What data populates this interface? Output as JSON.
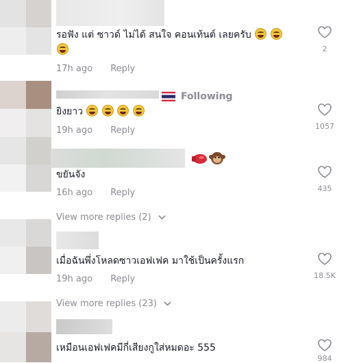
{
  "comments": [
    {
      "text": "รอฟัง แต่ ซาวด์ ไม่ได้ สนใจ คอนเท้นต์ เลยครับ",
      "time": "17h ago",
      "reply": "Reply",
      "likes": "2",
      "emojis": [
        "grin-sweat-emoji",
        "grin-sweat-emoji",
        "grin-sweat-emoji"
      ]
    },
    {
      "text": "ยิงยาว",
      "time": "19h ago",
      "reply": "Reply",
      "likes": "1057",
      "status": "Following",
      "emojis": [
        "grin-sweat-emoji",
        "grin-sweat-emoji",
        "grin-sweat-emoji",
        "grin-sweat-emoji"
      ]
    },
    {
      "text": "ขยันจัง",
      "time": "16h ago",
      "reply": "Reply",
      "likes": "435",
      "name_emojis": [
        "boxing-glove-emoji",
        "monkey-emoji"
      ]
    },
    {
      "text": "เมื่อฉันพึ่งโหลดซาวเอฟเฟค มาใช้เป็นครั้งแรก",
      "time": "19h ago",
      "reply": "Reply",
      "likes": "18.5K"
    },
    {
      "text": "เหมือนเอฟเฟคมีกี่เสียงกูใส่หมดอะ 555",
      "likes": "984"
    }
  ],
  "view_more": [
    {
      "label": "View more replies (2)"
    },
    {
      "label": "View more replies (23)"
    }
  ],
  "colors": {
    "text": "#161823",
    "muted": "#8a8b91",
    "background": "#ffffff"
  }
}
